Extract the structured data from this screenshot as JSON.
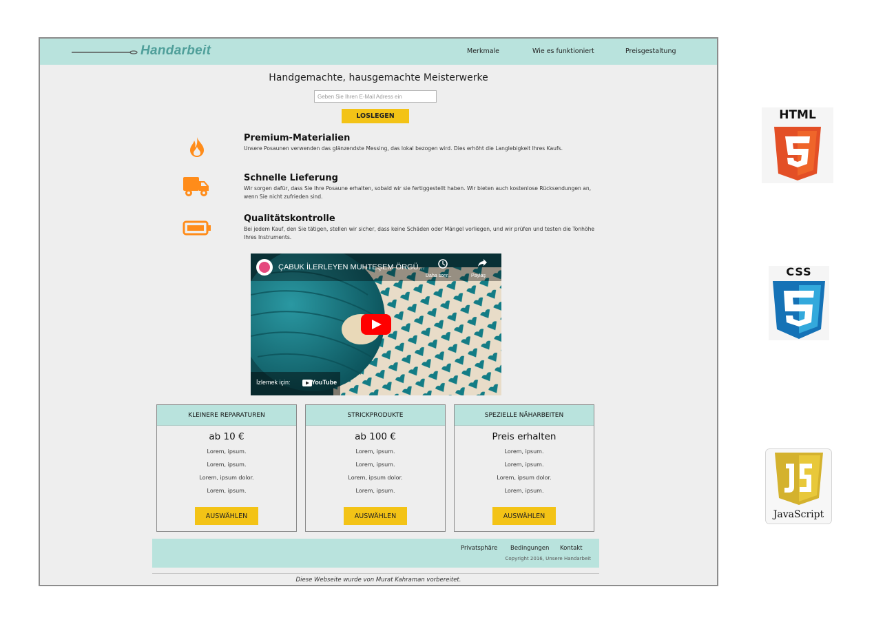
{
  "header": {
    "brand": "Handarbeit",
    "nav": [
      "Merkmale",
      "Wie es funktioniert",
      "Preisgestaltung"
    ]
  },
  "hero": {
    "headline": "Handgemachte, hausgemachte Meisterwerke",
    "email_placeholder": "Geben Sie Ihren E-Mail Adress ein",
    "cta_label": "LOSLEGEN"
  },
  "features": [
    {
      "icon": "fire-icon",
      "title": "Premium-Materialien",
      "text": "Unsere Posaunen verwenden das glänzendste Messing, das lokal bezogen wird. Dies erhöht die Langlebigkeit Ihres Kaufs."
    },
    {
      "icon": "truck-icon",
      "title": "Schnelle Lieferung",
      "text": "Wir sorgen dafür, dass Sie Ihre Posaune erhalten, sobald wir sie fertiggestellt haben. Wir bieten auch kostenlose Rücksendungen an, wenn Sie nicht zufrieden sind."
    },
    {
      "icon": "battery-icon",
      "title": "Qualitätskontrolle",
      "text": "Bei jedem Kauf, den Sie tätigen, stellen wir sicher, dass keine Schäden oder Mängel vorliegen, und wir prüfen und testen die Tonhöhe Ihres Instruments."
    }
  ],
  "video": {
    "title": "ÇABUK İLERLEYEN MUHTEŞEM ÖRGÜ...",
    "later_label": "Daha sonr...",
    "share_label": "Paylaş",
    "watch_label": "İzlemek için:",
    "platform_label": "YouTube"
  },
  "pricing": [
    {
      "name": "KLEINERE REPARATUREN",
      "price": "ab 10 €",
      "features": [
        "Lorem, ipsum.",
        "Lorem, ipsum.",
        "Lorem, ipsum dolor.",
        "Lorem, ipsum."
      ],
      "button": "AUSWÄHLEN"
    },
    {
      "name": "STRICKPRODUKTE",
      "price": "ab 100 €",
      "features": [
        "Lorem, ipsum.",
        "Lorem, ipsum.",
        "Lorem, ipsum dolor.",
        "Lorem, ipsum."
      ],
      "button": "AUSWÄHLEN"
    },
    {
      "name": "SPEZIELLE NÄHARBEITEN",
      "price": "Preis erhalten",
      "features": [
        "Lorem, ipsum.",
        "Lorem, ipsum.",
        "Lorem, ipsum dolor.",
        "Lorem, ipsum."
      ],
      "button": "AUSWÄHLEN"
    }
  ],
  "footer": {
    "links": [
      "Privatsphäre",
      "Bedingungen",
      "Kontakt"
    ],
    "copyright": "Copyright 2016, Unsere Handarbeit"
  },
  "credit": "Diese Webseite wurde von Murat Kahraman vorbereitet.",
  "tech": {
    "html_label": "HTML",
    "html_num": "5",
    "css_label": "CSS",
    "css_num": "3",
    "js_label": "JavaScript",
    "js_mark": "JS"
  },
  "colors": {
    "teal_bar": "#b9e3dd",
    "accent_yellow": "#f3c316",
    "icon_orange": "#ff8c1a",
    "brand_teal": "#4f9f9a"
  }
}
